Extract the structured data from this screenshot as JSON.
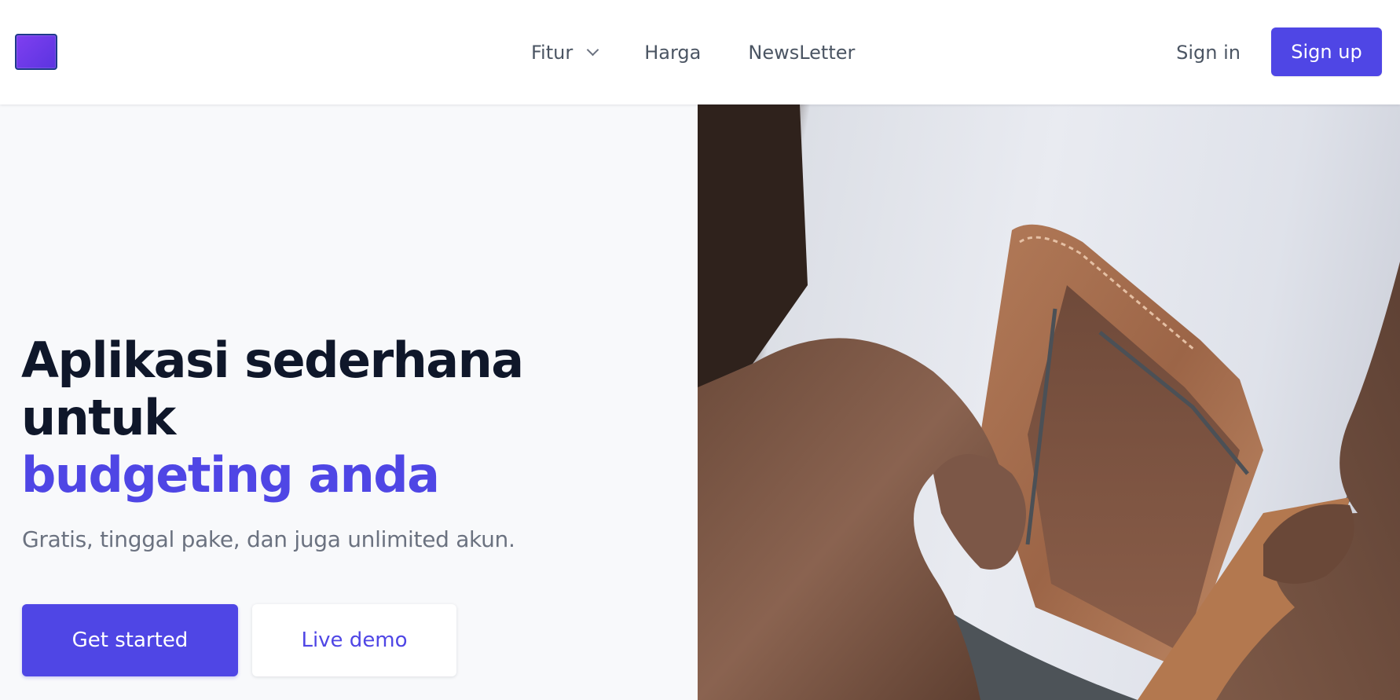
{
  "nav": {
    "logo_name": "app-logo",
    "links": {
      "fitur": "Fitur",
      "harga": "Harga",
      "newsletter": "NewsLetter"
    },
    "sign_in": "Sign in",
    "sign_up": "Sign up"
  },
  "hero": {
    "title_line1": "Aplikasi sederhana",
    "title_line2": "untuk",
    "title_accent": "budgeting anda",
    "subtitle": "Gratis, tinggal pake, dan juga unlimited akun.",
    "primary_cta": "Get started",
    "secondary_cta": "Live demo"
  },
  "photo": {
    "subject": "empty-wallet-in-hands"
  },
  "colors": {
    "brand": "#4f46e5",
    "heading": "#0f172a",
    "body_text": "#6b7280",
    "background": "#f8f9fb"
  }
}
